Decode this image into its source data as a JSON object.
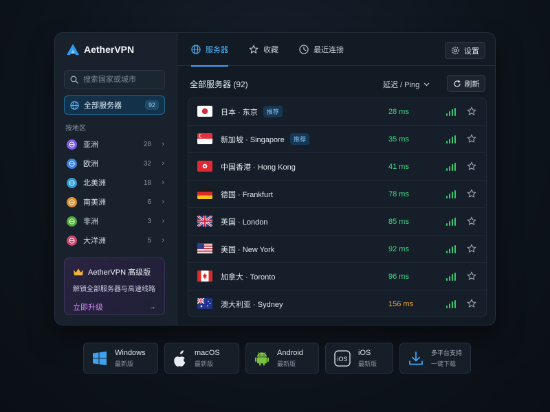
{
  "app": {
    "name": "AetherVPN"
  },
  "search": {
    "placeholder": "搜索国家或城市"
  },
  "sidebar": {
    "all_servers": {
      "label": "全部服务器",
      "count": "92"
    },
    "region_heading": "按地区",
    "regions": [
      {
        "name": "亚洲",
        "count": "28",
        "color": "#7b5cf0"
      },
      {
        "name": "欧洲",
        "count": "32",
        "color": "#3f7fe0"
      },
      {
        "name": "北美洲",
        "count": "18",
        "color": "#2f9bd6"
      },
      {
        "name": "南美洲",
        "count": "6",
        "color": "#e0902c"
      },
      {
        "name": "非洲",
        "count": "3",
        "color": "#54a83b"
      },
      {
        "name": "大洋洲",
        "count": "5",
        "color": "#d0456c"
      }
    ],
    "promo": {
      "title": "AetherVPN 高级版",
      "description": "解锁全部服务器与高速线路",
      "cta": "立即升级",
      "arrow": "→"
    }
  },
  "tabs": [
    {
      "label": "服务器",
      "icon": "globe-icon",
      "active": true
    },
    {
      "label": "收藏",
      "icon": "star-icon",
      "active": false
    },
    {
      "label": "最近连接",
      "icon": "clock-icon",
      "active": false
    }
  ],
  "toolbar": {
    "settings_label": "设置",
    "list_title": "全部服务器 (92)",
    "sort_label": "延迟 / Ping",
    "refresh_label": "刷新"
  },
  "servers": [
    {
      "name": "日本 · 东京",
      "tag": "推荐",
      "ping": "28 ms",
      "flag": "jp"
    },
    {
      "name": "新加坡 · Singapore",
      "tag": "推荐",
      "ping": "35 ms",
      "flag": "sg"
    },
    {
      "name": "中国香港 · Hong Kong",
      "tag": "",
      "ping": "41 ms",
      "flag": "hk"
    },
    {
      "name": "德国 · Frankfurt",
      "tag": "",
      "ping": "78 ms",
      "flag": "de"
    },
    {
      "name": "英国 · London",
      "tag": "",
      "ping": "85 ms",
      "flag": "gb"
    },
    {
      "name": "美国 · New York",
      "tag": "",
      "ping": "92 ms",
      "flag": "us"
    },
    {
      "name": "加拿大 · Toronto",
      "tag": "",
      "ping": "96 ms",
      "flag": "ca"
    },
    {
      "name": "澳大利亚 · Sydney",
      "tag": "",
      "ping": "156 ms",
      "flag": "au"
    }
  ],
  "downloads": [
    {
      "name": "Windows",
      "sub": "最新版",
      "icon": "windows-icon"
    },
    {
      "name": "macOS",
      "sub": "最新版",
      "icon": "apple-icon"
    },
    {
      "name": "Android",
      "sub": "最新版",
      "icon": "android-icon"
    },
    {
      "name": "iOS",
      "sub": "最新版",
      "icon": "ios-icon"
    },
    {
      "name": "多平台支持",
      "sub": "一键下载",
      "icon": "download-icon"
    }
  ],
  "colors": {
    "accent": "#3aa3ff",
    "ping_good": "#3ddc84",
    "ping_warn": "#f0a63a",
    "promo_cta": "#d68bff"
  }
}
